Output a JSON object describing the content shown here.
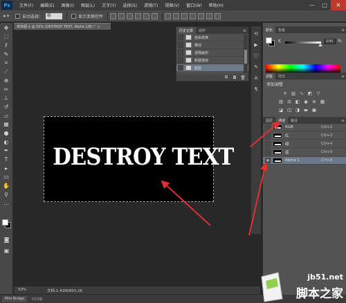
{
  "app": {
    "logo": "Ps"
  },
  "menu": [
    "文件(F)",
    "编辑(E)",
    "图像(I)",
    "图层(L)",
    "文字(Y)",
    "选择(S)",
    "滤镜(T)",
    "视图(V)",
    "窗口(W)",
    "帮助(H)"
  ],
  "window_controls": {
    "minimize": "—",
    "maximize": "□",
    "close": "✕"
  },
  "options_bar": {
    "auto_select_label": "自动选择：",
    "auto_select_value": "组",
    "show_transform_label": "显示变换控件"
  },
  "document": {
    "tab_title": "未标题-1 @ 50% (DESTROY TEXT, Alpha 1/8) *",
    "tab_close": "×",
    "canvas_text": "DESTROY  TEXT"
  },
  "status": {
    "zoom": "50%",
    "doc_info": "文档:1.43M/893.2K"
  },
  "bottom_tabs": [
    "Mini Bridge",
    "时间轴"
  ],
  "history_panel": {
    "tabs": [
      "历史记录",
      "动作"
    ],
    "items": [
      {
        "label": "自由变换",
        "selected": false
      },
      {
        "label": "移动",
        "selected": false
      },
      {
        "label": "选择画布",
        "selected": false
      },
      {
        "label": "新建通道",
        "selected": false
      },
      {
        "label": "粘贴",
        "selected": true
      }
    ]
  },
  "color_panel": {
    "tabs": [
      "颜色",
      "色板"
    ],
    "channel_label": "K",
    "value": "100",
    "unit": "%"
  },
  "adjustments_panel": {
    "tabs": [
      "调整",
      "样式"
    ],
    "title": "添加调整"
  },
  "channels_panel": {
    "tabs": [
      "图层",
      "通道",
      "路径"
    ],
    "channels": [
      {
        "name": "RGB",
        "shortcut": "Ctrl+2",
        "selected": false,
        "visible": false
      },
      {
        "name": "红",
        "shortcut": "Ctrl+3",
        "selected": false,
        "visible": false
      },
      {
        "name": "绿",
        "shortcut": "Ctrl+4",
        "selected": false,
        "visible": false
      },
      {
        "name": "蓝",
        "shortcut": "Ctrl+5",
        "selected": false,
        "visible": false
      },
      {
        "name": "Alpha 1",
        "shortcut": "Ctrl+6",
        "selected": true,
        "visible": true
      }
    ]
  },
  "watermark": {
    "url": "jb51.net",
    "name": "脚本之家"
  },
  "colors": {
    "annotation_arrow": "#e03030",
    "selection_highlight": "#6a7889"
  }
}
